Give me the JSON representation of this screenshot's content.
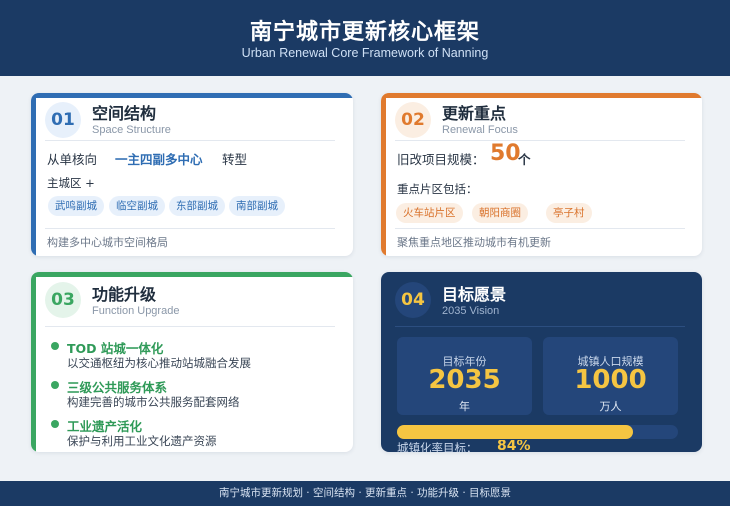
{
  "header": {
    "title": "南宁城市更新核心框架",
    "subtitle": "Urban Renewal Core Framework of Nanning"
  },
  "cards": {
    "space": {
      "num": "01",
      "title": "空间结构",
      "subtitle": "Space Structure",
      "line_prefix": "从单核向",
      "line_highlight": "一主四副多中心",
      "line_suffix": "转型",
      "main_area": "主城区 +",
      "tags": [
        "武鸣副城",
        "临空副城",
        "东部副城",
        "南部副城"
      ],
      "footer": "构建多中心城市空间格局",
      "accent": "#2f6db3"
    },
    "renewal": {
      "num": "02",
      "title": "更新重点",
      "subtitle": "Renewal Focus",
      "scale_label": "旧改项目规模：",
      "scale_value": "50",
      "scale_unit": "个",
      "areas_label": "重点片区包括：",
      "tags": [
        "火车站片区",
        "朝阳商圈",
        "亭子村"
      ],
      "footer": "聚焦重点地区推动城市有机更新",
      "accent": "#e07a2e"
    },
    "function": {
      "num": "03",
      "title": "功能升级",
      "subtitle": "Function Upgrade",
      "items": [
        {
          "title": "TOD 站城一体化",
          "desc": "以交通枢纽为核心推动站城融合发展"
        },
        {
          "title": "三级公共服务体系",
          "desc": "构建完善的城市公共服务配套网络"
        },
        {
          "title": "工业遗产活化",
          "desc": "保护与利用工业文化遗产资源"
        }
      ],
      "accent": "#3aa661"
    },
    "vision": {
      "num": "04",
      "title": "目标愿景",
      "subtitle": "2035 Vision",
      "year_label": "目标年份",
      "year_value": "2035",
      "year_unit": "年",
      "pop_label": "城镇人口规模",
      "pop_value": "1000",
      "pop_unit": "万人",
      "urban_label": "城镇化率目标：",
      "urban_value": "84%",
      "urbanization_rate": 0.84,
      "accent": "#f5c542"
    }
  },
  "footer": {
    "text": "南宁城市更新规划 · 空间结构 · 更新重点 · 功能升级 · 目标愿景"
  }
}
